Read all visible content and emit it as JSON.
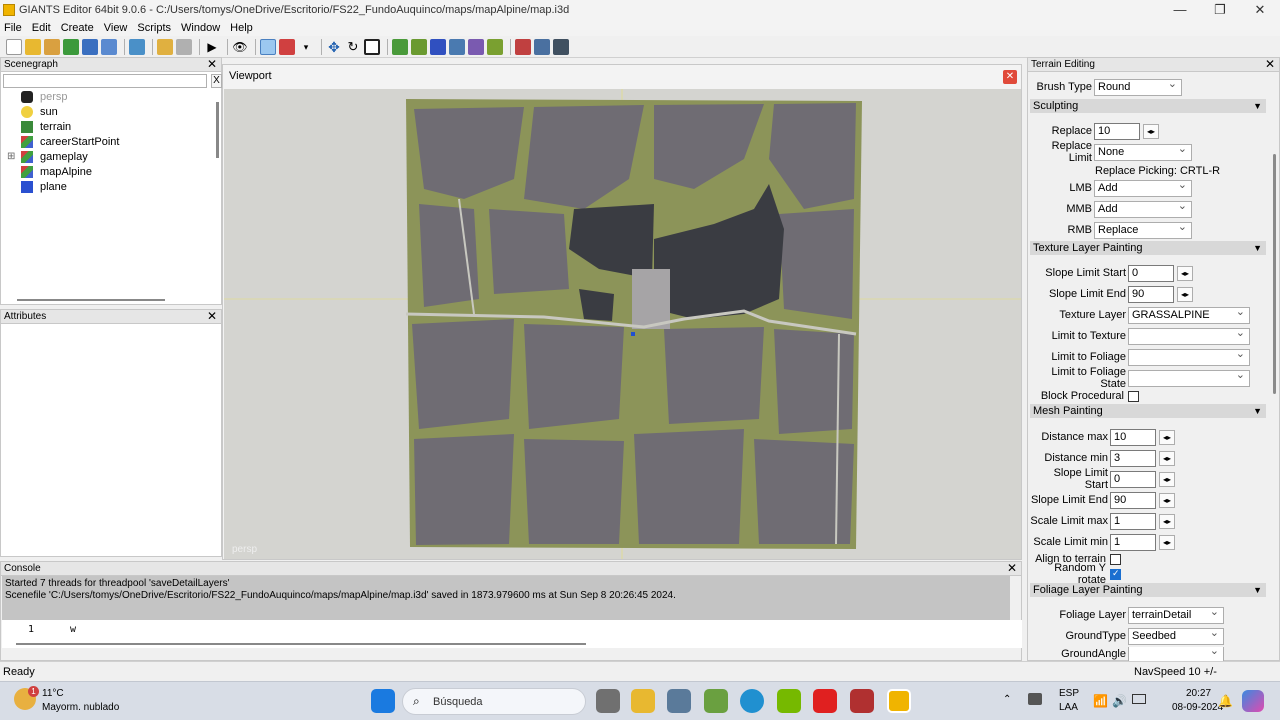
{
  "window": {
    "title": "GIANTS Editor 64bit 9.0.6 - C:/Users/tomys/OneDrive/Escritorio/FS22_FundoAuquinco/maps/mapAlpine/map.i3d",
    "minimize": "—",
    "maximize": "❐",
    "close": "✕"
  },
  "menu": [
    "File",
    "Edit",
    "Create",
    "View",
    "Scripts",
    "Window",
    "Help"
  ],
  "scenegraph": {
    "title": "Scenegraph",
    "close": "✕",
    "clear": "X",
    "items": [
      {
        "label": "persp",
        "icon": "camera-icon"
      },
      {
        "label": "sun",
        "icon": "light-icon"
      },
      {
        "label": "terrain",
        "icon": "terrain-icon"
      },
      {
        "label": "careerStartPoint",
        "icon": "transform-group-icon"
      },
      {
        "label": "gameplay",
        "icon": "transform-group-icon"
      },
      {
        "label": "mapAlpine",
        "icon": "transform-group-icon"
      },
      {
        "label": "plane",
        "icon": "cube-icon"
      }
    ],
    "expand": "⊞"
  },
  "attributes": {
    "title": "Attributes",
    "close": "✕"
  },
  "viewport": {
    "title": "Viewport",
    "close": "✕",
    "camera": "persp"
  },
  "terrain_editing": {
    "title": "Terrain Editing",
    "close": "✕",
    "brush_type_label": "Brush Type",
    "brush_type": "Round",
    "sculpting": {
      "title": "Sculpting",
      "replace_label": "Replace",
      "replace": "10",
      "replace_limit_label": "Replace Limit",
      "replace_limit": "None",
      "picking_hint": "Replace Picking: CRTL-R",
      "lmb_label": "LMB",
      "lmb": "Add",
      "mmb_label": "MMB",
      "mmb": "Add",
      "rmb_label": "RMB",
      "rmb": "Replace"
    },
    "texture_painting": {
      "title": "Texture Layer Painting",
      "slope_start_label": "Slope Limit Start",
      "slope_start": "0",
      "slope_end_label": "Slope Limit End",
      "slope_end": "90",
      "texture_layer_label": "Texture Layer",
      "texture_layer": "GRASSALPINE",
      "limit_texture_label": "Limit to Texture",
      "limit_texture": "",
      "limit_foliage_label": "Limit to Foliage",
      "limit_foliage": "",
      "limit_foliage_state_label": "Limit to Foliage State",
      "limit_foliage_state": "",
      "block_procedural_label": "Block Procedural"
    },
    "mesh_painting": {
      "title": "Mesh Painting",
      "dist_max_label": "Distance max",
      "dist_max": "10",
      "dist_min_label": "Distance min",
      "dist_min": "3",
      "slope_start_label": "Slope Limit Start",
      "slope_start": "0",
      "slope_end_label": "Slope Limit End",
      "slope_end": "90",
      "scale_max_label": "Scale Limit max",
      "scale_max": "1",
      "scale_min_label": "Scale Limit min",
      "scale_min": "1",
      "align_label": "Align to terrain",
      "random_y_label": "Random Y rotate"
    },
    "foliage_painting": {
      "title": "Foliage Layer Painting",
      "foliage_layer_label": "Foliage Layer",
      "foliage_layer": "terrainDetail",
      "ground_type_label": "GroundType",
      "ground_type": "Seedbed",
      "ground_angle_label": "GroundAngle",
      "ground_angle": ""
    },
    "spin": "◂▸",
    "collapse": "▼"
  },
  "console": {
    "title": "Console",
    "close": "✕",
    "lines": [
      "Started 7 threads for threadpool 'saveDetailLayers'",
      "Scenefile 'C:/Users/tomys/OneDrive/Escritorio/FS22_FundoAuquinco/maps/mapAlpine/map.i3d' saved in 1873.979600 ms at Sun Sep  8 20:26:45 2024."
    ],
    "line_no": "1",
    "input": "w"
  },
  "status": {
    "left": "Ready",
    "right": "NavSpeed 10 +/-"
  },
  "taskbar": {
    "weather_temp": "11°C",
    "weather_desc": "Mayorm. nublado",
    "weather_badge": "1",
    "search_placeholder": "Búsqueda",
    "lang": "ESP",
    "lang2": "LAA",
    "time": "20:27",
    "date": "08-09-2024"
  },
  "colors": {
    "grass": "#8c9459",
    "field": "#6f6c73",
    "dark_field": "#3a3c42",
    "road": "#c8c8c0",
    "accent": "#1a6fd0"
  }
}
